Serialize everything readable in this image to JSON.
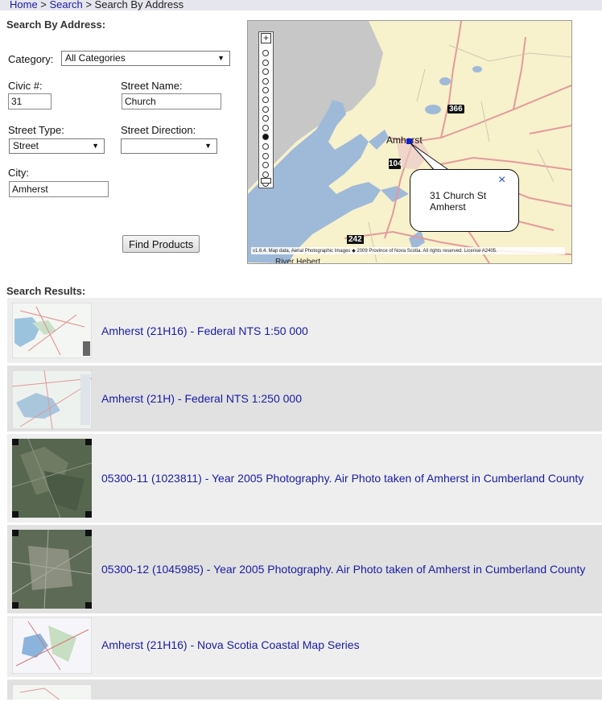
{
  "breadcrumb": {
    "home": "Home",
    "sep1": " > ",
    "search": "Search",
    "sep2": " > ",
    "current": "Search By Address"
  },
  "form": {
    "heading": "Search By Address:",
    "category_label": "Category:",
    "category_value": "All Categories",
    "civic_label": "Civic #:",
    "civic_value": "31",
    "street_name_label": "Street Name:",
    "street_name_value": "Church",
    "street_type_label": "Street Type:",
    "street_type_value": "Street",
    "street_dir_label": "Street Direction:",
    "street_dir_value": "",
    "city_label": "City:",
    "city_value": "Amherst",
    "find_button": "Find Products"
  },
  "map": {
    "town_label": "Amherst",
    "road_366": "366",
    "road_104": "104",
    "road_242": "242",
    "lower_label": "River Hebert",
    "popup_line1": "31 Church St",
    "popup_line2": "Amherst",
    "copyright": "v1.6.4. Map data, Aerial Photographic Images ◆ 2009 Province of Nova Scotia. All rights reserved. License A2405.",
    "zoom_levels": 15,
    "zoom_selected": 9
  },
  "results": {
    "heading": "Search Results:",
    "items": [
      {
        "title": "Amherst (21H16) - Federal NTS 1:50 000",
        "thumb": "topo"
      },
      {
        "title": "Amherst (21H) - Federal NTS 1:250 000",
        "thumb": "topo2"
      },
      {
        "title": "05300-11 (1023811) - Year 2005 Photography. Air Photo taken of Amherst in Cumberland County",
        "thumb": "photo"
      },
      {
        "title": "05300-12 (1045985) - Year 2005 Photography. Air Photo taken of Amherst in Cumberland County",
        "thumb": "photo"
      },
      {
        "title": "Amherst (21H16) - Nova Scotia Coastal Map Series",
        "thumb": "coastal"
      }
    ]
  },
  "colors": {
    "link": "#1a1aa6",
    "water": "#9fb9d9",
    "land": "#f7f1cc",
    "road": "#e39a9a"
  }
}
